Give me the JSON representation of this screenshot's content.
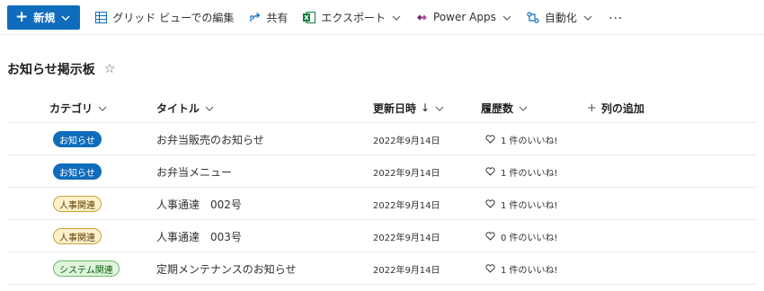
{
  "colors": {
    "accent": "#0f6cbd",
    "excel": "#107c41",
    "powerapps": "#742774"
  },
  "command_bar": {
    "new_label": "新規",
    "grid_edit_label": "グリッド ビューでの編集",
    "share_label": "共有",
    "export_label": "エクスポート",
    "power_apps_label": "Power Apps",
    "automate_label": "自動化",
    "more_label": "⋯"
  },
  "page": {
    "title": "お知らせ掲示板",
    "favorite_icon": "star-icon"
  },
  "table": {
    "headers": {
      "category": "カテゴリ",
      "title": "タイトル",
      "updated": "更新日時",
      "sort_arrow": "↓",
      "history": "履歴数",
      "add_column": "列の追加"
    },
    "rows": [
      {
        "category": "お知らせ",
        "category_style": "blue",
        "title": "お弁当販売のお知らせ",
        "updated": "2022年9月14日",
        "likes": "1 件のいいね!"
      },
      {
        "category": "お知らせ",
        "category_style": "blue",
        "title": "お弁当メニュー",
        "updated": "2022年9月14日",
        "likes": "1 件のいいね!"
      },
      {
        "category": "人事関連",
        "category_style": "yellow",
        "title": "人事通達　002号",
        "updated": "2022年9月14日",
        "likes": "1 件のいいね!"
      },
      {
        "category": "人事関連",
        "category_style": "yellow",
        "title": "人事通達　003号",
        "updated": "2022年9月14日",
        "likes": "0 件のいいね!"
      },
      {
        "category": "システム関連",
        "category_style": "green",
        "title": "定期メンテナンスのお知らせ",
        "updated": "2022年9月14日",
        "likes": "1 件のいいね!"
      }
    ]
  }
}
